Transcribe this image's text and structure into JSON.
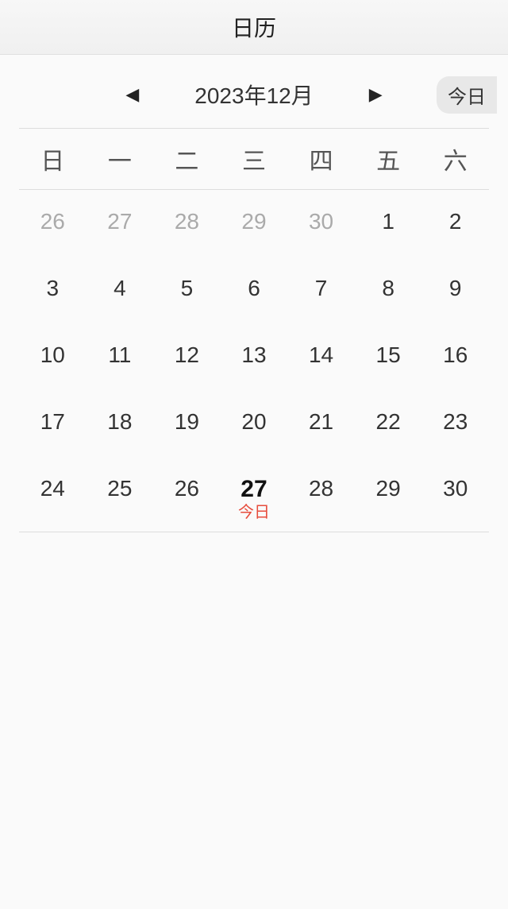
{
  "header": {
    "title": "日历"
  },
  "nav": {
    "prev_icon": "◀",
    "next_icon": "▶",
    "month_label": "2023年12月",
    "today_button": "今日"
  },
  "weekdays": [
    "日",
    "一",
    "二",
    "三",
    "四",
    "五",
    "六"
  ],
  "days": [
    {
      "num": "26",
      "other": true,
      "today": false
    },
    {
      "num": "27",
      "other": true,
      "today": false
    },
    {
      "num": "28",
      "other": true,
      "today": false
    },
    {
      "num": "29",
      "other": true,
      "today": false
    },
    {
      "num": "30",
      "other": true,
      "today": false
    },
    {
      "num": "1",
      "other": false,
      "today": false
    },
    {
      "num": "2",
      "other": false,
      "today": false
    },
    {
      "num": "3",
      "other": false,
      "today": false
    },
    {
      "num": "4",
      "other": false,
      "today": false
    },
    {
      "num": "5",
      "other": false,
      "today": false
    },
    {
      "num": "6",
      "other": false,
      "today": false
    },
    {
      "num": "7",
      "other": false,
      "today": false
    },
    {
      "num": "8",
      "other": false,
      "today": false
    },
    {
      "num": "9",
      "other": false,
      "today": false
    },
    {
      "num": "10",
      "other": false,
      "today": false
    },
    {
      "num": "11",
      "other": false,
      "today": false
    },
    {
      "num": "12",
      "other": false,
      "today": false
    },
    {
      "num": "13",
      "other": false,
      "today": false
    },
    {
      "num": "14",
      "other": false,
      "today": false
    },
    {
      "num": "15",
      "other": false,
      "today": false
    },
    {
      "num": "16",
      "other": false,
      "today": false
    },
    {
      "num": "17",
      "other": false,
      "today": false
    },
    {
      "num": "18",
      "other": false,
      "today": false
    },
    {
      "num": "19",
      "other": false,
      "today": false
    },
    {
      "num": "20",
      "other": false,
      "today": false
    },
    {
      "num": "21",
      "other": false,
      "today": false
    },
    {
      "num": "22",
      "other": false,
      "today": false
    },
    {
      "num": "23",
      "other": false,
      "today": false
    },
    {
      "num": "24",
      "other": false,
      "today": false
    },
    {
      "num": "25",
      "other": false,
      "today": false
    },
    {
      "num": "26",
      "other": false,
      "today": false
    },
    {
      "num": "27",
      "other": false,
      "today": true
    },
    {
      "num": "28",
      "other": false,
      "today": false
    },
    {
      "num": "29",
      "other": false,
      "today": false
    },
    {
      "num": "30",
      "other": false,
      "today": false
    }
  ],
  "today_mark_label": "今日"
}
